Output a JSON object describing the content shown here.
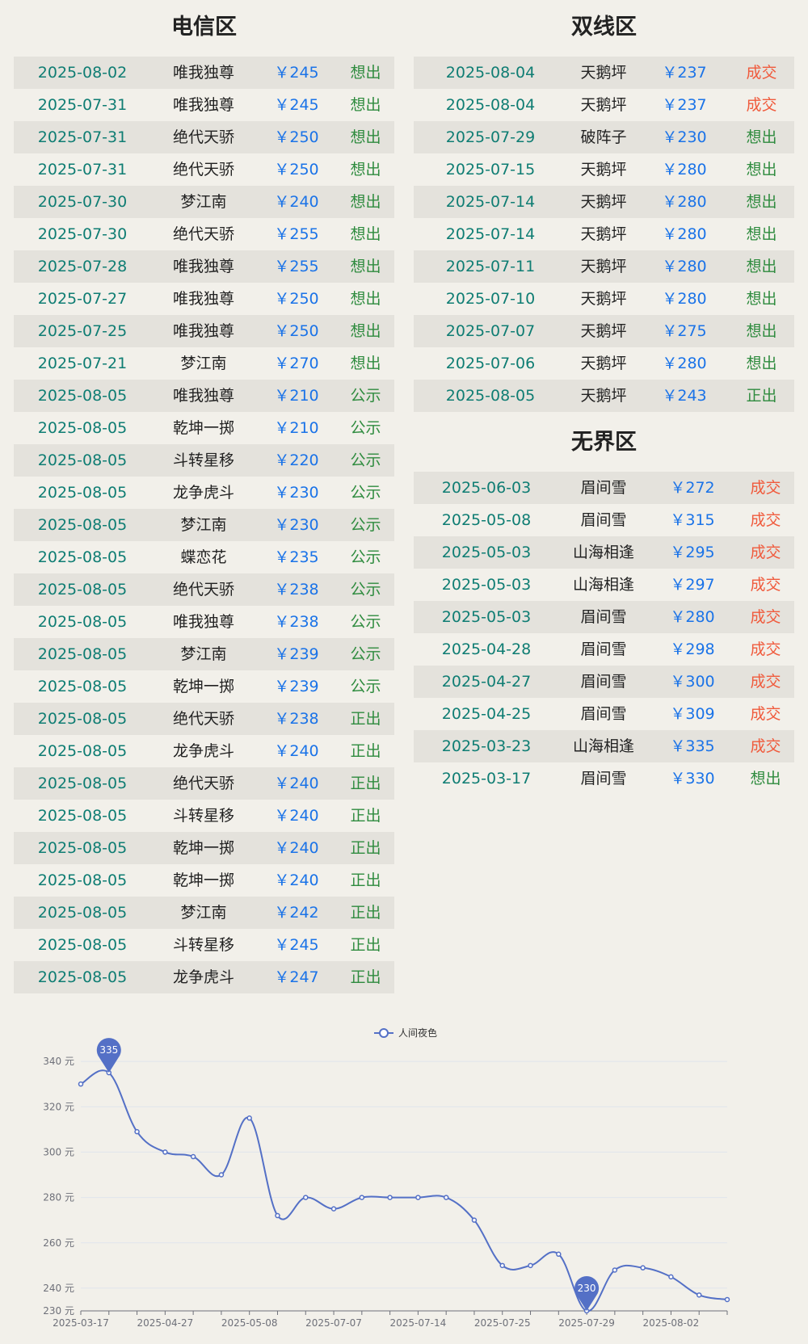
{
  "sections": {
    "dianxin": {
      "title": "电信区",
      "rows": [
        {
          "date": "2025-08-02",
          "name": "唯我独尊",
          "price": "￥245",
          "status": "想出"
        },
        {
          "date": "2025-07-31",
          "name": "唯我独尊",
          "price": "￥245",
          "status": "想出"
        },
        {
          "date": "2025-07-31",
          "name": "绝代天骄",
          "price": "￥250",
          "status": "想出"
        },
        {
          "date": "2025-07-31",
          "name": "绝代天骄",
          "price": "￥250",
          "status": "想出"
        },
        {
          "date": "2025-07-30",
          "name": "梦江南",
          "price": "￥240",
          "status": "想出"
        },
        {
          "date": "2025-07-30",
          "name": "绝代天骄",
          "price": "￥255",
          "status": "想出"
        },
        {
          "date": "2025-07-28",
          "name": "唯我独尊",
          "price": "￥255",
          "status": "想出"
        },
        {
          "date": "2025-07-27",
          "name": "唯我独尊",
          "price": "￥250",
          "status": "想出"
        },
        {
          "date": "2025-07-25",
          "name": "唯我独尊",
          "price": "￥250",
          "status": "想出"
        },
        {
          "date": "2025-07-21",
          "name": "梦江南",
          "price": "￥270",
          "status": "想出"
        },
        {
          "date": "2025-08-05",
          "name": "唯我独尊",
          "price": "￥210",
          "status": "公示"
        },
        {
          "date": "2025-08-05",
          "name": "乾坤一掷",
          "price": "￥210",
          "status": "公示"
        },
        {
          "date": "2025-08-05",
          "name": "斗转星移",
          "price": "￥220",
          "status": "公示"
        },
        {
          "date": "2025-08-05",
          "name": "龙争虎斗",
          "price": "￥230",
          "status": "公示"
        },
        {
          "date": "2025-08-05",
          "name": "梦江南",
          "price": "￥230",
          "status": "公示"
        },
        {
          "date": "2025-08-05",
          "name": "蝶恋花",
          "price": "￥235",
          "status": "公示"
        },
        {
          "date": "2025-08-05",
          "name": "绝代天骄",
          "price": "￥238",
          "status": "公示"
        },
        {
          "date": "2025-08-05",
          "name": "唯我独尊",
          "price": "￥238",
          "status": "公示"
        },
        {
          "date": "2025-08-05",
          "name": "梦江南",
          "price": "￥239",
          "status": "公示"
        },
        {
          "date": "2025-08-05",
          "name": "乾坤一掷",
          "price": "￥239",
          "status": "公示"
        },
        {
          "date": "2025-08-05",
          "name": "绝代天骄",
          "price": "￥238",
          "status": "正出"
        },
        {
          "date": "2025-08-05",
          "name": "龙争虎斗",
          "price": "￥240",
          "status": "正出"
        },
        {
          "date": "2025-08-05",
          "name": "绝代天骄",
          "price": "￥240",
          "status": "正出"
        },
        {
          "date": "2025-08-05",
          "name": "斗转星移",
          "price": "￥240",
          "status": "正出"
        },
        {
          "date": "2025-08-05",
          "name": "乾坤一掷",
          "price": "￥240",
          "status": "正出"
        },
        {
          "date": "2025-08-05",
          "name": "乾坤一掷",
          "price": "￥240",
          "status": "正出"
        },
        {
          "date": "2025-08-05",
          "name": "梦江南",
          "price": "￥242",
          "status": "正出"
        },
        {
          "date": "2025-08-05",
          "name": "斗转星移",
          "price": "￥245",
          "status": "正出"
        },
        {
          "date": "2025-08-05",
          "name": "龙争虎斗",
          "price": "￥247",
          "status": "正出"
        }
      ]
    },
    "shuangxian": {
      "title": "双线区",
      "rows": [
        {
          "date": "2025-08-04",
          "name": "天鹅坪",
          "price": "￥237",
          "status": "成交"
        },
        {
          "date": "2025-08-04",
          "name": "天鹅坪",
          "price": "￥237",
          "status": "成交"
        },
        {
          "date": "2025-07-29",
          "name": "破阵子",
          "price": "￥230",
          "status": "想出"
        },
        {
          "date": "2025-07-15",
          "name": "天鹅坪",
          "price": "￥280",
          "status": "想出"
        },
        {
          "date": "2025-07-14",
          "name": "天鹅坪",
          "price": "￥280",
          "status": "想出"
        },
        {
          "date": "2025-07-14",
          "name": "天鹅坪",
          "price": "￥280",
          "status": "想出"
        },
        {
          "date": "2025-07-11",
          "name": "天鹅坪",
          "price": "￥280",
          "status": "想出"
        },
        {
          "date": "2025-07-10",
          "name": "天鹅坪",
          "price": "￥280",
          "status": "想出"
        },
        {
          "date": "2025-07-07",
          "name": "天鹅坪",
          "price": "￥275",
          "status": "想出"
        },
        {
          "date": "2025-07-06",
          "name": "天鹅坪",
          "price": "￥280",
          "status": "想出"
        },
        {
          "date": "2025-08-05",
          "name": "天鹅坪",
          "price": "￥243",
          "status": "正出"
        }
      ]
    },
    "wujie": {
      "title": "无界区",
      "rows": [
        {
          "date": "2025-06-03",
          "name": "眉间雪",
          "price": "￥272",
          "status": "成交"
        },
        {
          "date": "2025-05-08",
          "name": "眉间雪",
          "price": "￥315",
          "status": "成交"
        },
        {
          "date": "2025-05-03",
          "name": "山海相逢",
          "price": "￥295",
          "status": "成交"
        },
        {
          "date": "2025-05-03",
          "name": "山海相逢",
          "price": "￥297",
          "status": "成交"
        },
        {
          "date": "2025-05-03",
          "name": "眉间雪",
          "price": "￥280",
          "status": "成交"
        },
        {
          "date": "2025-04-28",
          "name": "眉间雪",
          "price": "￥298",
          "status": "成交"
        },
        {
          "date": "2025-04-27",
          "name": "眉间雪",
          "price": "￥300",
          "status": "成交"
        },
        {
          "date": "2025-04-25",
          "name": "眉间雪",
          "price": "￥309",
          "status": "成交"
        },
        {
          "date": "2025-03-23",
          "name": "山海相逢",
          "price": "￥335",
          "status": "成交"
        },
        {
          "date": "2025-03-17",
          "name": "眉间雪",
          "price": "￥330",
          "status": "想出"
        }
      ]
    }
  },
  "colors": {
    "date": "#0f7d73",
    "price": "#1a73e8",
    "status_sell": "#2e8b3e",
    "status_deal": "#f05a3c",
    "series": "#5470c6"
  },
  "chart_data": {
    "type": "line",
    "smooth": true,
    "legend": {
      "position": "top-center"
    },
    "series": [
      {
        "name": "人间夜色",
        "values": [
          330,
          335,
          309,
          300,
          298,
          290,
          315,
          272,
          280,
          275,
          280,
          280,
          280,
          280,
          270,
          250,
          250,
          255,
          230,
          248,
          249,
          245,
          237,
          235
        ]
      }
    ],
    "x_tick_labels": [
      "2025-03-17",
      "2025-04-27",
      "2025-05-08",
      "2025-07-07",
      "2025-07-14",
      "2025-07-25",
      "2025-07-29",
      "2025-08-02"
    ],
    "x_tick_every": 3,
    "y_ticks": [
      230,
      240,
      260,
      280,
      300,
      320,
      340
    ],
    "y_tick_suffix": " 元",
    "ylim": [
      230,
      350
    ],
    "grid": true,
    "markers": [
      {
        "type": "max",
        "index": 1,
        "label": "335"
      },
      {
        "type": "min",
        "index": 18,
        "label": "230"
      }
    ]
  }
}
